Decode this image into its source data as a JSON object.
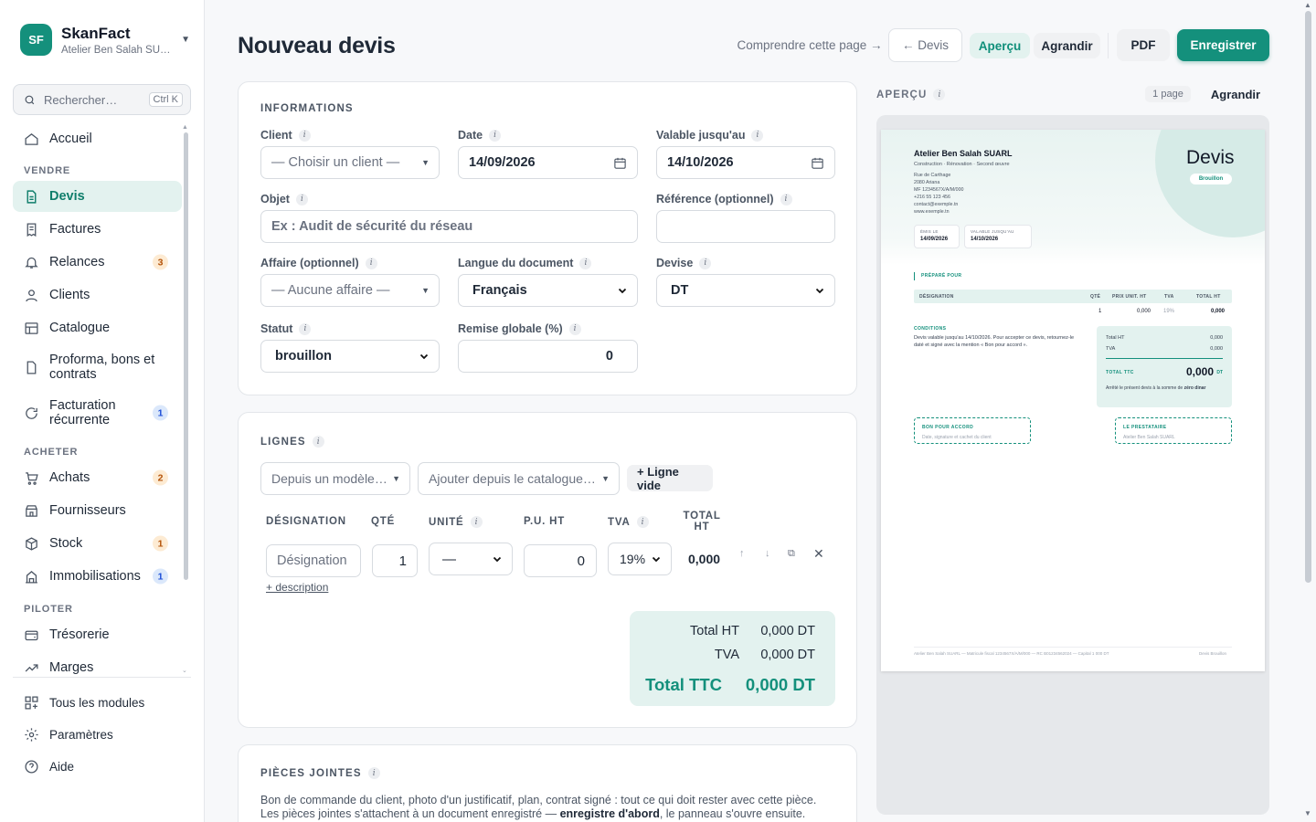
{
  "brand": {
    "initials": "SF",
    "name": "SkanFact",
    "company": "Atelier Ben Salah SU…"
  },
  "search": {
    "placeholder": "Rechercher…",
    "shortcut": "Ctrl K"
  },
  "nav": {
    "home": "Accueil",
    "sections": {
      "vendre": "VENDRE",
      "acheter": "ACHETER",
      "piloter": "PILOTER"
    },
    "devis": "Devis",
    "factures": "Factures",
    "relances": "Relances",
    "relances_badge": "3",
    "clients": "Clients",
    "catalogue": "Catalogue",
    "proforma": "Proforma, bons et contrats",
    "recurrente": "Facturation récurrente",
    "recurrente_badge": "1",
    "achats": "Achats",
    "achats_badge": "2",
    "fournisseurs": "Fournisseurs",
    "stock": "Stock",
    "stock_badge": "1",
    "immobilisations": "Immobilisations",
    "immobilisations_badge": "1",
    "tresorerie": "Trésorerie",
    "marges": "Marges"
  },
  "nav_bottom": {
    "modules": "Tous les modules",
    "parametres": "Paramètres",
    "aide": "Aide"
  },
  "header": {
    "title": "Nouveau devis",
    "help_link": "Comprendre cette page →",
    "back": "← Devis",
    "apercu": "Aperçu",
    "agrandir": "Agrandir",
    "pdf": "PDF",
    "save": "Enregistrer"
  },
  "informations": {
    "title": "INFORMATIONS",
    "client_label": "Client",
    "client_placeholder": "— Choisir un client —",
    "date_label": "Date",
    "date_value": "14/09/2026",
    "valid_label": "Valable jusqu'au",
    "valid_value": "14/10/2026",
    "objet_label": "Objet",
    "objet_placeholder": "Ex : Audit de sécurité du réseau",
    "ref_label": "Référence (optionnel)",
    "affaire_label": "Affaire (optionnel)",
    "affaire_placeholder": "— Aucune affaire —",
    "langue_label": "Langue du document",
    "langue_value": "Français",
    "devise_label": "Devise",
    "devise_value": "DT",
    "statut_label": "Statut",
    "statut_value": "brouillon",
    "remise_label": "Remise globale (%)",
    "remise_value": "0"
  },
  "lignes": {
    "title": "LIGNES",
    "template_placeholder": "Depuis un modèle…",
    "catalogue_placeholder": "Ajouter depuis le catalogue…",
    "empty_line": "+ Ligne vide",
    "headers": {
      "designation": "DÉSIGNATION",
      "qte": "QTÉ",
      "unite": "UNITÉ",
      "pu": "P.U. HT",
      "tva": "TVA",
      "total": "TOTAL HT"
    },
    "row": {
      "designation_placeholder": "Désignation",
      "qte": "1",
      "unite": "—",
      "pu": "0",
      "tva": "19%",
      "total": "0,000"
    },
    "add_description": "+ description",
    "totals": {
      "ht_label": "Total HT",
      "ht_value": "0,000 DT",
      "tva_label": "TVA",
      "tva_value": "0,000 DT",
      "ttc_label": "Total TTC",
      "ttc_value": "0,000 DT"
    }
  },
  "pieces": {
    "title": "PIÈCES JOINTES",
    "text_before": "Bon de commande du client, photo d'un justificatif, plan, contrat signé : tout ce qui doit rester avec cette pièce. Les pièces jointes s'attachent à un document enregistré — ",
    "text_bold": "enregistre d'abord",
    "text_after": ", le panneau s'ouvre ensuite."
  },
  "preview": {
    "label": "APERÇU",
    "pages": "1 page",
    "agrandir": "Agrandir",
    "doc": {
      "company": "Atelier Ben Salah SUARL",
      "activities": "Construction · Rénovation · Second œuvre",
      "address": [
        "Rue de Carthage",
        "2080 Ariana",
        "MF 1234567X/A/M/000",
        "+216 55 123 456",
        "contact@exemple.tn",
        "www.exemple.tn"
      ],
      "doc_title": "Devis",
      "doc_status": "Brouillon",
      "emis_label": "ÉMIS LE",
      "emis_value": "14/09/2026",
      "valable_label": "VALABLE JUSQU'AU",
      "valable_value": "14/10/2026",
      "prepare_label": "PRÉPARÉ POUR",
      "th": {
        "designation": "DÉSIGNATION",
        "qte": "QTÉ",
        "pu": "PRIX UNIT. HT",
        "tva": "TVA",
        "total": "TOTAL HT"
      },
      "row": {
        "qte": "1",
        "pu": "0,000",
        "tva": "19%",
        "total": "0,000"
      },
      "conditions_label": "CONDITIONS",
      "conditions_text": "Devis valable jusqu'au 14/10/2026. Pour accepter ce devis, retournez-le daté et signé avec la mention « Bon pour accord ».",
      "total_ht_label": "Total HT",
      "total_ht_value": "0,000",
      "tva_label": "TVA",
      "tva_value": "0,000",
      "ttc_label": "TOTAL TTC",
      "ttc_value": "0,000",
      "ttc_unit": "DT",
      "arrete_text": "Arrêté le présent devis à la somme de ",
      "arrete_bold": "zéro dinar",
      "bon_label": "BON POUR ACCORD",
      "bon_text": "Date, signature et cachet du client",
      "prest_label": "LE PRESTATAIRE",
      "prest_text": "Atelier Ben Salah SUARL",
      "footer_left": "Atelier Ben Salah SUARL — Matricule fiscal 1234567X/A/M/000 — RC B01234562024 — Capital 1 000 DT",
      "footer_right": "Devis Brouillon"
    }
  },
  "colors": {
    "accent": "#14907c",
    "accent_light": "#e3f2ef"
  }
}
